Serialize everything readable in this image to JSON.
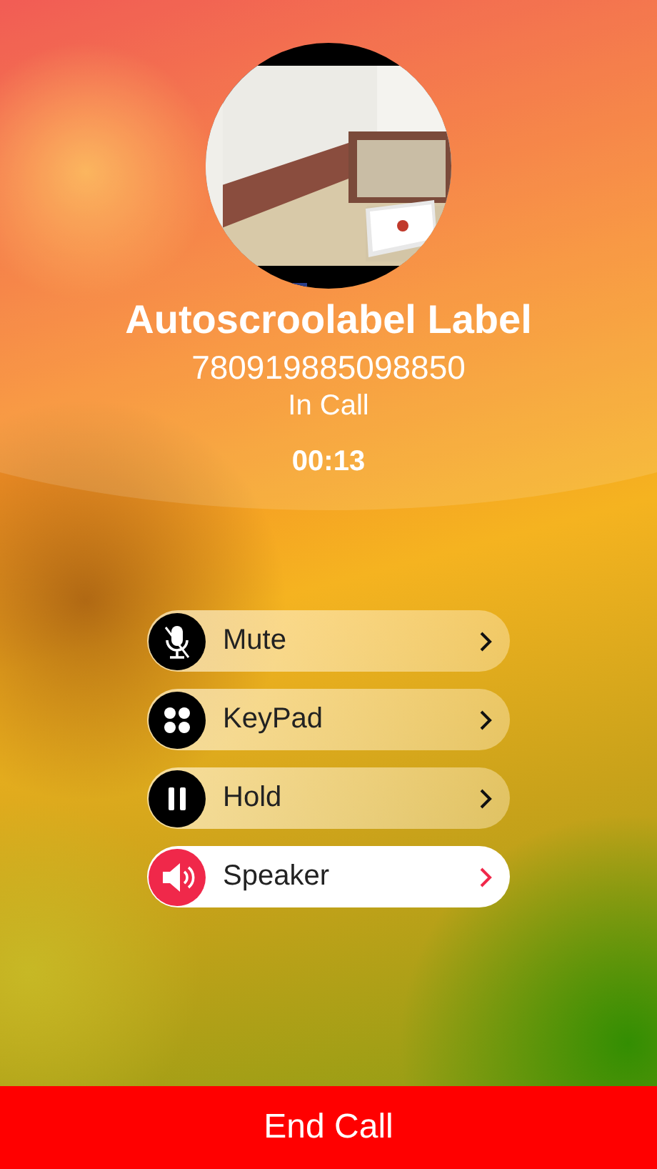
{
  "caller": {
    "name": "Autoscroolabel Label",
    "number": "780919885098850",
    "status": "In Call",
    "timer": "00:13"
  },
  "options": [
    {
      "kind": "mute",
      "label": "Mute",
      "selected": false
    },
    {
      "kind": "keypad",
      "label": "KeyPad",
      "selected": false
    },
    {
      "kind": "hold",
      "label": "Hold",
      "selected": false
    },
    {
      "kind": "speaker",
      "label": "Speaker",
      "selected": true
    }
  ],
  "end_button": "End Call"
}
